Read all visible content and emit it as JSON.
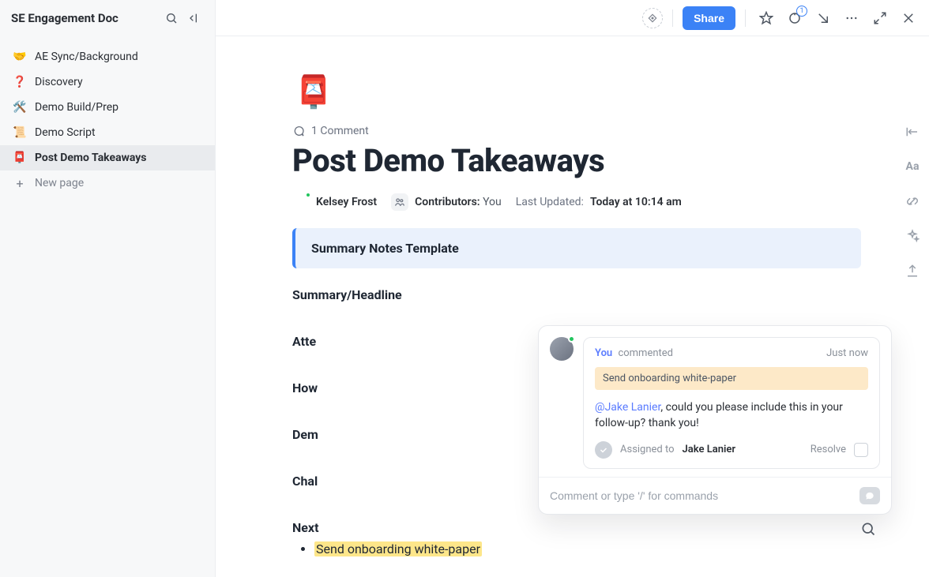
{
  "sidebar": {
    "title": "SE Engagement Doc",
    "items": [
      {
        "emoji": "🤝",
        "label": "AE Sync/Background"
      },
      {
        "emoji": "❓",
        "label": "Discovery"
      },
      {
        "emoji": "🛠️",
        "label": "Demo Build/Prep"
      },
      {
        "emoji": "📜",
        "label": "Demo Script"
      },
      {
        "emoji": "📮",
        "label": "Post Demo Takeaways"
      }
    ],
    "new_page_label": "New page"
  },
  "topbar": {
    "share_label": "Share",
    "notification_count": "1"
  },
  "doc": {
    "page_emoji": "📮",
    "comment_count_label": "1 Comment",
    "title": "Post Demo Takeaways",
    "author_name": "Kelsey Frost",
    "contributors_label": "Contributors:",
    "contributors_value": "You",
    "last_updated_label": "Last Updated:",
    "last_updated_value": "Today at 10:14 am",
    "callout_text": "Summary Notes Template",
    "sections": {
      "s1": "Summary/Headline",
      "s2": "Atte",
      "s3": "How",
      "s4": "Dem",
      "s5": "Chal",
      "s6": "Next"
    },
    "next_step_item": "Send onboarding white-paper"
  },
  "popover": {
    "you_label": "You",
    "commented_label": "commented",
    "time_label": "Just now",
    "quote_text": "Send onboarding white-paper",
    "mention": "@Jake Lanier",
    "message_tail": ", could you please include this in your follow-up? thank you!",
    "assigned_label": "Assigned to",
    "assignee": "Jake Lanier",
    "resolve_label": "Resolve",
    "input_placeholder": "Comment or type '/' for commands"
  }
}
